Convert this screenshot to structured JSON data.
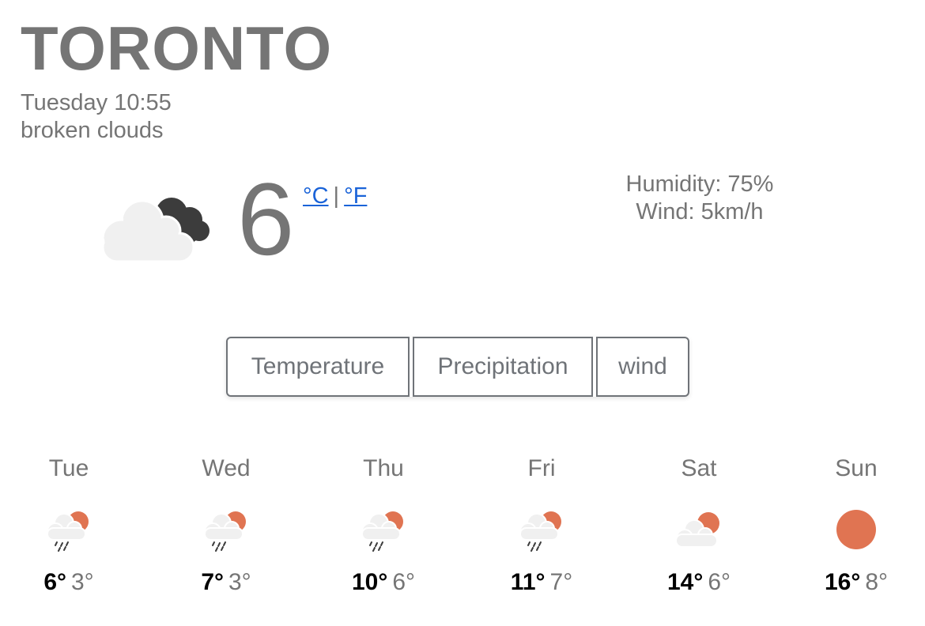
{
  "location": {
    "city": "TORONTO",
    "day_time": "Tuesday 10:55",
    "description": "broken clouds"
  },
  "current": {
    "temperature": "6",
    "unit_celsius": "°C",
    "unit_separator": "|",
    "unit_fahrenheit": "°F",
    "humidity": "Humidity: 75%",
    "wind": "Wind: 5km/h",
    "icon": "broken-clouds-icon"
  },
  "tabs": [
    {
      "label": "Temperature"
    },
    {
      "label": "Precipitation"
    },
    {
      "label": "wind"
    }
  ],
  "forecast": [
    {
      "day": "Tue",
      "high": "6°",
      "low": "3°",
      "icon": "rain-sun-icon"
    },
    {
      "day": "Wed",
      "high": "7°",
      "low": "3°",
      "icon": "rain-sun-icon"
    },
    {
      "day": "Thu",
      "high": "10°",
      "low": "6°",
      "icon": "rain-sun-icon"
    },
    {
      "day": "Fri",
      "high": "11°",
      "low": "7°",
      "icon": "rain-sun-icon"
    },
    {
      "day": "Sat",
      "high": "14°",
      "low": "6°",
      "icon": "partly-cloudy-icon"
    },
    {
      "day": "Sun",
      "high": "16°",
      "low": "8°",
      "icon": "sun-icon"
    }
  ],
  "colors": {
    "text_gray": "#757575",
    "link_blue": "#1a63d8",
    "sun_orange": "#e07452",
    "cloud_light": "#f0f0f0",
    "cloud_dark": "#3c3c3c"
  }
}
